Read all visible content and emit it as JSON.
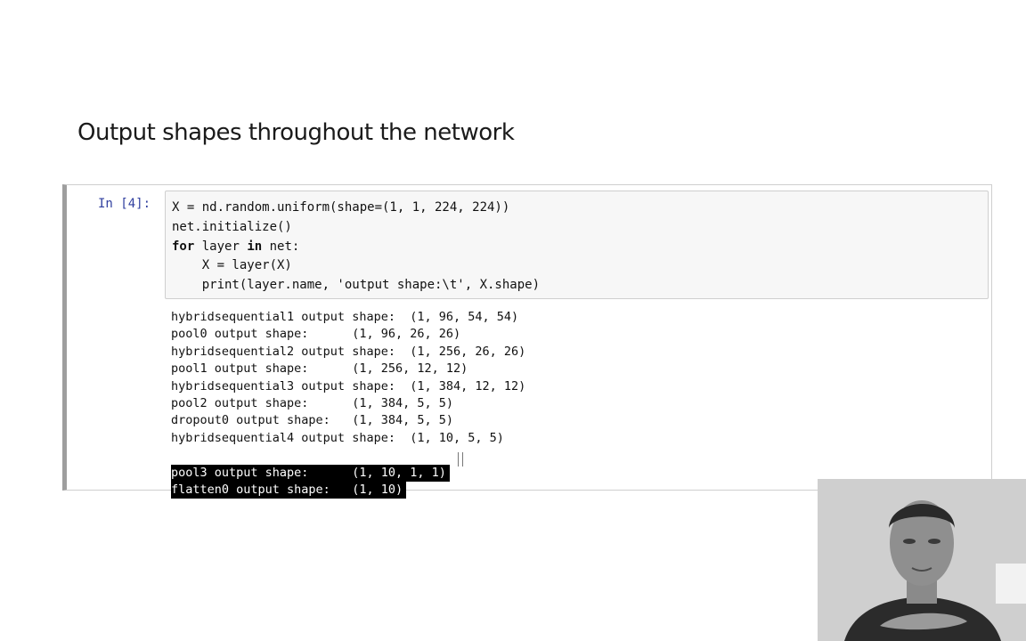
{
  "slide": {
    "title": "Output shapes throughout the network"
  },
  "cell": {
    "prompt": "In [4]:",
    "code_lines": [
      "X = nd.random.uniform(shape=(1, 1, 224, 224))",
      "net.initialize()",
      "for layer in net:",
      "    X = layer(X)",
      "    print(layer.name, 'output shape:\\t', X.shape)"
    ],
    "output_lines": [
      "hybridsequential1 output shape:  (1, 96, 54, 54)",
      "pool0 output shape:      (1, 96, 26, 26)",
      "hybridsequential2 output shape:  (1, 256, 26, 26)",
      "pool1 output shape:      (1, 256, 12, 12)",
      "hybridsequential3 output shape:  (1, 384, 12, 12)",
      "pool2 output shape:      (1, 384, 5, 5)",
      "dropout0 output shape:   (1, 384, 5, 5)",
      "hybridsequential4 output shape:  (1, 10, 5, 5)",
      "pool3 output shape:      (1, 10, 1, 1)",
      "flatten0 output shape:   (1, 10)"
    ]
  }
}
